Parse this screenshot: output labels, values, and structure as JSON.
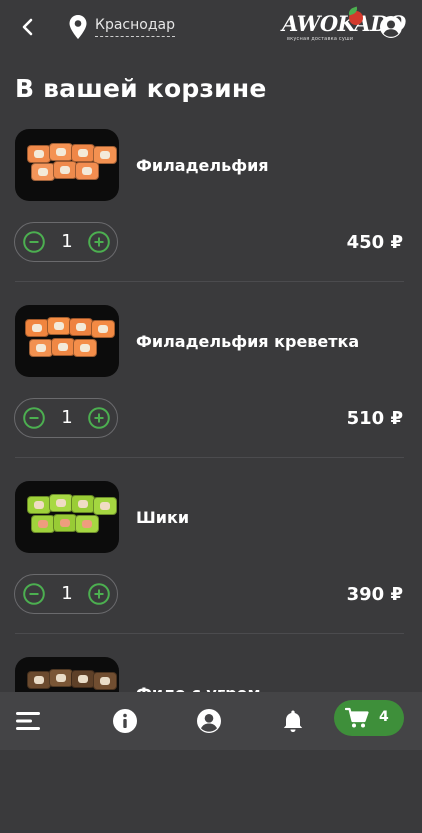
{
  "header": {
    "city": "Краснодар",
    "logo_text": "AWOKADO",
    "logo_tagline": "вкусная доставка суши"
  },
  "page_title": "В вашей корзине",
  "items": [
    {
      "name": "Филадельфия",
      "qty": "1",
      "price": "450 ₽",
      "image": "salmon-roll-photo"
    },
    {
      "name": "Филадельфия креветка",
      "qty": "1",
      "price": "510 ₽",
      "image": "shrimp-salmon-roll-photo"
    },
    {
      "name": "Шики",
      "qty": "1",
      "price": "390 ₽",
      "image": "green-tobiko-roll-photo"
    },
    {
      "name": "Фило с угрем",
      "image": "eel-roll-photo"
    }
  ],
  "bottom_nav": {
    "cart_count": "4",
    "icons": [
      "menu-icon",
      "info-icon",
      "account-icon",
      "bell-icon",
      "cart-icon"
    ]
  },
  "colors": {
    "background": "#3a3a3c",
    "accent_green": "#3e8f3a",
    "stepper_green": "#4caf50"
  }
}
